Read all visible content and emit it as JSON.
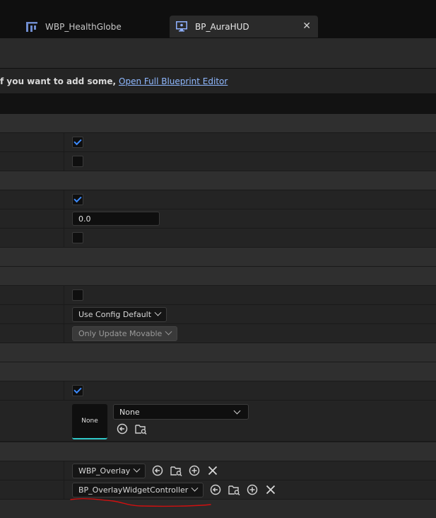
{
  "tabs": [
    {
      "label": "WBP_HealthGlobe",
      "icon": "widget-blueprint-icon"
    },
    {
      "label": "BP_AuraHUD",
      "icon": "hud-blueprint-icon",
      "active": true
    }
  ],
  "notice": {
    "text": "f you want to add some,",
    "link": "Open Full Blueprint Editor"
  },
  "fields": {
    "float_value": "0.0",
    "config_combo": "Use Config Default",
    "update_combo": "Only Update Movable",
    "thumb_label": "None",
    "asset_combo": "None",
    "overlay_widget_class": "WBP_Overlay",
    "overlay_controller_class": "BP_OverlayWidgetController"
  },
  "colors": {
    "accent_check": "#3d8bff",
    "annotation_red": "#d01010",
    "thumb_underline": "#2fc8c8"
  }
}
